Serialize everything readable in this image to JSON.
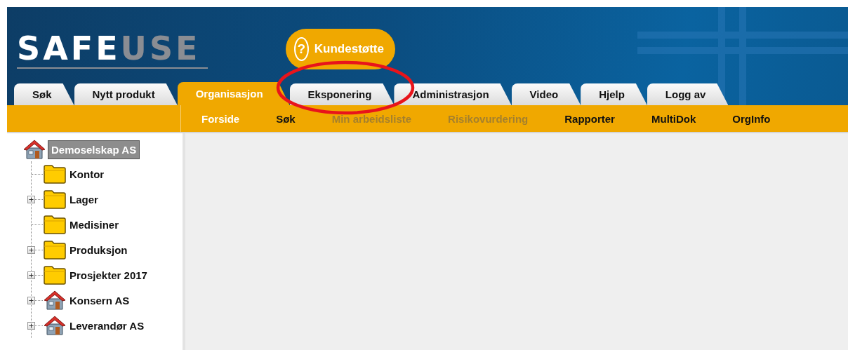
{
  "logo": {
    "primary": "SAFE",
    "secondary": "USE"
  },
  "support_button": {
    "icon": "?",
    "label": "Kundestøtte"
  },
  "tabs": [
    {
      "label": "Søk",
      "selected": false
    },
    {
      "label": "Nytt produkt",
      "selected": false
    },
    {
      "label": "Organisasjon",
      "selected": true
    },
    {
      "label": "Eksponering",
      "selected": false
    },
    {
      "label": "Administrasjon",
      "selected": false
    },
    {
      "label": "Video",
      "selected": false
    },
    {
      "label": "Hjelp",
      "selected": false
    },
    {
      "label": "Logg av",
      "selected": false
    }
  ],
  "subnav": [
    {
      "label": "Forside",
      "selected": true,
      "disabled": false
    },
    {
      "label": "Søk",
      "selected": false,
      "disabled": false
    },
    {
      "label": "Min arbeidsliste",
      "selected": false,
      "disabled": true
    },
    {
      "label": "Risikovurdering",
      "selected": false,
      "disabled": true
    },
    {
      "label": "Rapporter",
      "selected": false,
      "disabled": false
    },
    {
      "label": "MultiDok",
      "selected": false,
      "disabled": false
    },
    {
      "label": "OrgInfo",
      "selected": false,
      "disabled": false
    }
  ],
  "tree": {
    "label": "Demoselskap AS",
    "kind": "company",
    "selected": true,
    "children": [
      {
        "label": "Kontor",
        "kind": "folder",
        "collapsed": false,
        "selected": false
      },
      {
        "label": "Lager",
        "kind": "folder",
        "collapsed": true,
        "selected": false
      },
      {
        "label": "Medisiner",
        "kind": "folder",
        "collapsed": false,
        "selected": false
      },
      {
        "label": "Produksjon",
        "kind": "folder",
        "collapsed": true,
        "selected": false
      },
      {
        "label": "Prosjekter 2017",
        "kind": "folder",
        "collapsed": true,
        "selected": false
      },
      {
        "label": "Konsern AS",
        "kind": "company",
        "collapsed": true,
        "selected": false
      },
      {
        "label": "Leverandør AS",
        "kind": "company",
        "collapsed": true,
        "selected": false
      }
    ]
  },
  "annotation": {
    "kind": "ellipse",
    "color": "#e8141b"
  }
}
